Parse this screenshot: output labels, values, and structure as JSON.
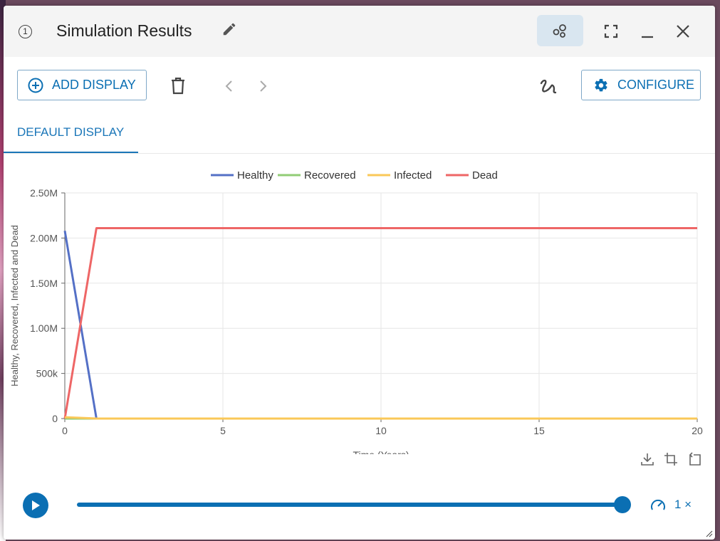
{
  "window": {
    "step": "1",
    "title": "Simulation Results"
  },
  "toolbar": {
    "add_display_label": "ADD DISPLAY",
    "configure_label": "CONFIGURE"
  },
  "tabs": [
    {
      "label": "DEFAULT DISPLAY",
      "active": true
    }
  ],
  "playback": {
    "speed_label": "1 ×",
    "progress": 1.0
  },
  "colors": {
    "accent": "#0b6fb3",
    "healthy": "#5470c6",
    "recovered": "#91cc75",
    "infected": "#fac858",
    "dead": "#ee6666"
  },
  "icons": [
    "step-number-icon",
    "edit-icon",
    "model-icon",
    "fullscreen-icon",
    "minimize-icon",
    "close-icon",
    "add-circle-icon",
    "trash-icon",
    "chevron-left-icon",
    "chevron-right-icon",
    "squiggle-icon",
    "gear-icon",
    "download-icon",
    "crop-icon",
    "reset-zoom-icon",
    "play-icon",
    "speed-icon"
  ],
  "chart_data": {
    "type": "line",
    "title": "",
    "xlabel": "Time (Years)",
    "ylabel": "Healthy, Recovered, Infected and Dead",
    "xlim": [
      0,
      20
    ],
    "ylim": [
      0,
      2500000
    ],
    "x_ticks": [
      "0",
      "5",
      "10",
      "15",
      "20"
    ],
    "y_ticks": [
      "0",
      "500k",
      "1.00M",
      "1.50M",
      "2.00M",
      "2.50M"
    ],
    "grid": true,
    "legend_position": "top",
    "series": [
      {
        "name": "Healthy",
        "x": [
          0,
          1,
          2,
          5,
          10,
          15,
          20
        ],
        "values": [
          2080000,
          0,
          0,
          0,
          0,
          0,
          0
        ]
      },
      {
        "name": "Recovered",
        "x": [
          0,
          1,
          2,
          5,
          10,
          15,
          20
        ],
        "values": [
          0,
          0,
          0,
          0,
          0,
          0,
          0
        ]
      },
      {
        "name": "Infected",
        "x": [
          0,
          1,
          2,
          5,
          10,
          15,
          20
        ],
        "values": [
          15000,
          0,
          0,
          0,
          0,
          0,
          0
        ]
      },
      {
        "name": "Dead",
        "x": [
          0,
          1,
          2,
          5,
          10,
          15,
          20
        ],
        "values": [
          0,
          2110000,
          2110000,
          2110000,
          2110000,
          2110000,
          2110000
        ]
      }
    ]
  }
}
